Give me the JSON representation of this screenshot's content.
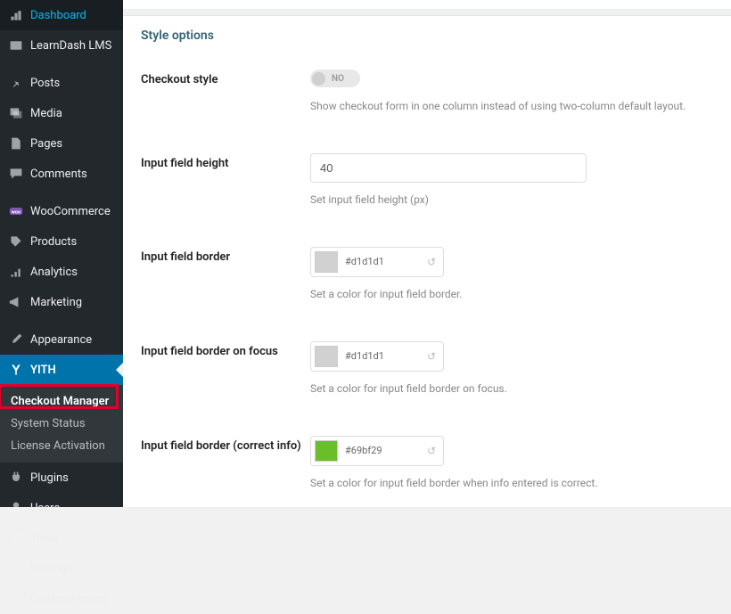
{
  "sidebar": {
    "items": [
      {
        "label": "Dashboard"
      },
      {
        "label": "LearnDash LMS"
      },
      {
        "label": "Posts"
      },
      {
        "label": "Media"
      },
      {
        "label": "Pages"
      },
      {
        "label": "Comments"
      },
      {
        "label": "WooCommerce"
      },
      {
        "label": "Products"
      },
      {
        "label": "Analytics"
      },
      {
        "label": "Marketing"
      },
      {
        "label": "Appearance"
      },
      {
        "label": "YITH"
      }
    ],
    "submenu": [
      {
        "label": "Checkout Manager"
      },
      {
        "label": "System Status"
      },
      {
        "label": "License Activation"
      }
    ],
    "bottom_items": [
      {
        "label": "Plugins"
      },
      {
        "label": "Users"
      },
      {
        "label": "Tools"
      },
      {
        "label": "Settings"
      },
      {
        "label": "Collapse menu"
      }
    ]
  },
  "main": {
    "section_title": "Style options",
    "rows": {
      "checkout_style": {
        "label": "Checkout style",
        "toggle_text": "NO",
        "help": "Show checkout form in one column instead of using two-column default layout."
      },
      "input_height": {
        "label": "Input field height",
        "value": "40",
        "help": "Set input field height (px)"
      },
      "input_border": {
        "label": "Input field border",
        "color_value": "#d1d1d1",
        "swatch": "#d1d1d1",
        "help": "Set a color for input field border."
      },
      "input_border_focus": {
        "label": "Input field border on focus",
        "color_value": "#d1d1d1",
        "swatch": "#d1d1d1",
        "help": "Set a color for input field border on focus."
      },
      "input_border_correct": {
        "label": "Input field border (correct info)",
        "color_value": "#69bf29",
        "swatch": "#69bf29",
        "help": "Set a color for input field border when info entered is correct."
      }
    }
  }
}
